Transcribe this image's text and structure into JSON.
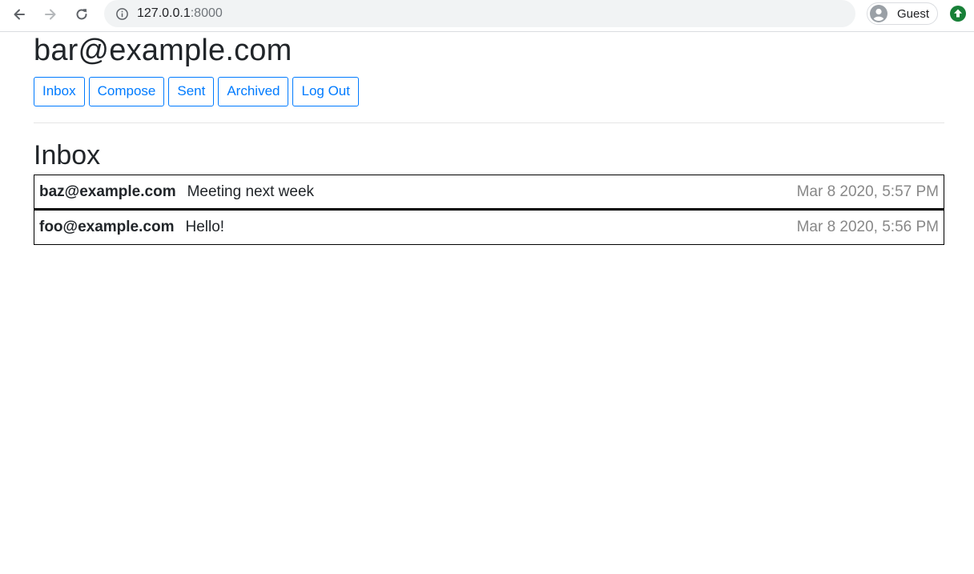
{
  "browser": {
    "url_host": "127.0.0.1",
    "url_port": ":8000",
    "profile_label": "Guest",
    "icons": {
      "back": "arrow-left-icon",
      "forward": "arrow-right-icon",
      "reload": "reload-icon",
      "info": "info-icon",
      "avatar": "avatar-icon",
      "update": "update-icon"
    }
  },
  "page": {
    "user_email": "bar@example.com",
    "nav": [
      {
        "label": "Inbox"
      },
      {
        "label": "Compose"
      },
      {
        "label": "Sent"
      },
      {
        "label": "Archived"
      },
      {
        "label": "Log Out"
      }
    ],
    "mailbox_title": "Inbox",
    "emails": [
      {
        "sender": "baz@example.com",
        "subject": "Meeting next week",
        "timestamp": "Mar 8 2020, 5:57 PM"
      },
      {
        "sender": "foo@example.com",
        "subject": "Hello!",
        "timestamp": "Mar 8 2020, 5:56 PM"
      }
    ]
  },
  "colors": {
    "accent": "#007bff",
    "timestamp": "#888888",
    "text": "#212529",
    "update_badge": "#188038"
  }
}
